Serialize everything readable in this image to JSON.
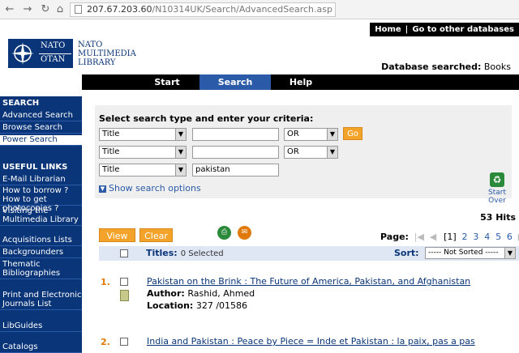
{
  "browser": {
    "url_host": "207.67.203.60",
    "url_path": "/N10314UK/Search/AdvancedSearch.asp"
  },
  "toplinks": {
    "home": "Home",
    "other_db": "Go to other databases"
  },
  "logo": {
    "nato": "NATO",
    "otan": "OTAN"
  },
  "library_name": [
    "NATO",
    "MULTIMEDIA",
    "LIBRARY"
  ],
  "database": {
    "label": "Database searched:",
    "value": "Books"
  },
  "mainnav": [
    "Start",
    "Search",
    "Help"
  ],
  "sidebar": {
    "search_head": "SEARCH",
    "search_links": [
      "Advanced Search",
      "Browse Search",
      "Power Search"
    ],
    "useful_head": "USEFUL LINKS",
    "useful_links": [
      "E-Mail Librarian",
      "How to borrow ? How to get photocopies ?",
      "Visiting the Multimedia Library",
      "Acquisitions Lists",
      "Backgrounders",
      "Thematic Bibliographies",
      "Print and Electronic Journals List",
      "LibGuides",
      "Catalogs"
    ]
  },
  "search": {
    "title": "Select search type and enter your criteria:",
    "rows": [
      {
        "field": "Title",
        "value": "",
        "op": "OR"
      },
      {
        "field": "Title",
        "value": "",
        "op": "OR"
      },
      {
        "field": "Title",
        "value": "pakistan"
      }
    ],
    "go": "Go",
    "show_options": "Show search options",
    "start_over": "Start Over"
  },
  "results": {
    "hits": "53 Hits",
    "view": "View",
    "clear": "Clear",
    "page_label": "Page:",
    "pages": [
      "1",
      "2",
      "3",
      "4",
      "5",
      "6"
    ],
    "current_page": "[1]",
    "titles_label": "Titles:",
    "selected": "0 Selected",
    "sort_label": "Sort:",
    "sort_value": "----- Not Sorted -----",
    "items": [
      {
        "num": "1.",
        "title": "Pakistan on the Brink : The Future of America, Pakistan, and Afghanistan",
        "author_label": "Author:",
        "author": "Rashid, Ahmed",
        "location_label": "Location:",
        "location": "327 /01586"
      },
      {
        "num": "2.",
        "title": "India and Pakistan : Peace by Piece = Inde et Pakistan : la paix, pas a pas"
      }
    ]
  },
  "colors": {
    "navy": "#0a3578",
    "accent": "#2a5aa8",
    "orange": "#f4a32a"
  }
}
